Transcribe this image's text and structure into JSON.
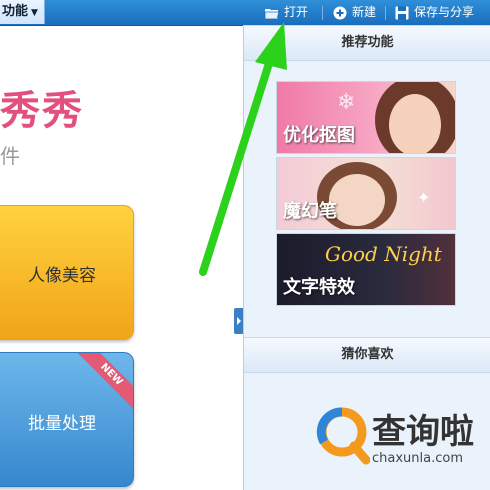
{
  "toolbar": {
    "menu_label": "功能",
    "open_label": "打开",
    "new_label": "新建",
    "save_share_label": "保存与分享"
  },
  "workspace": {
    "brand_fragment": "秀秀",
    "subtitle_fragment": "件",
    "tiles": [
      {
        "label": "人像美容"
      },
      {
        "label": "批量处理",
        "badge": "NEW"
      }
    ]
  },
  "panel": {
    "recommended_title": "推荐功能",
    "cards": [
      {
        "label": "优化抠图"
      },
      {
        "label": "魔幻笔"
      },
      {
        "label": "文字特效",
        "script_text": "Good Night"
      }
    ],
    "guess_title": "猜你喜欢"
  },
  "watermark": {
    "text": "查询啦",
    "url": "chaxunla.com"
  },
  "colors": {
    "toolbar_blue": "#1a6dbd",
    "brand_pink": "#e2517d",
    "tile_orange": "#f1a418",
    "tile_blue": "#3687cf",
    "arrow_green": "#2bd11a"
  }
}
